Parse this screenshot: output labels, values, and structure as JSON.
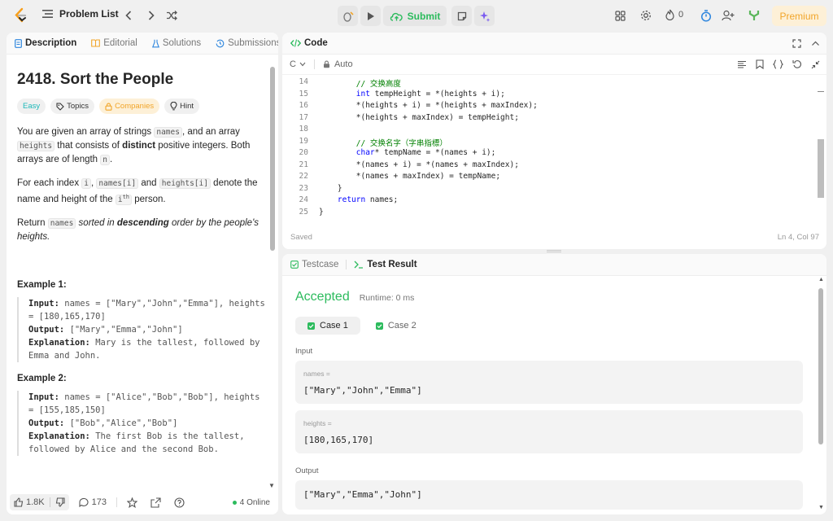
{
  "topbar": {
    "problem_list": "Problem List",
    "submit": "Submit",
    "streak": "0",
    "premium": "Premium"
  },
  "left": {
    "tabs": [
      "Description",
      "Editorial",
      "Solutions",
      "Submissions"
    ],
    "title": "2418. Sort the People",
    "tags": [
      "Easy",
      "Topics",
      "Companies",
      "Hint"
    ],
    "p1": {
      "a": "You are given an array of strings",
      "names": "names",
      "b": ", and an array",
      "heights": "heights",
      "c": "that consists of",
      "distinct": "distinct",
      "d": "positive integers. Both arrays are of length",
      "n": "n",
      "e": "."
    },
    "p2": {
      "a": "For each index",
      "i": "i",
      "names_i": "names[i]",
      "and": "and",
      "heights_i": "heights[i]",
      "b": "denote the name and height of the",
      "ith": "i",
      "sup": "th",
      "c": "person."
    },
    "p3": {
      "a": "Return",
      "names": "names",
      "b": "sorted in",
      "descending": "descending",
      "c": "order by the people's heights."
    },
    "examples": [
      {
        "title": "Example 1:",
        "input_label": "Input:",
        "input": "names = [\"Mary\",\"John\",\"Emma\"], heights = [180,165,170]",
        "output_label": "Output:",
        "output": "[\"Mary\",\"Emma\",\"John\"]",
        "expl_label": "Explanation:",
        "expl": "Mary is the tallest, followed by Emma and John."
      },
      {
        "title": "Example 2:",
        "input_label": "Input:",
        "input": "names = [\"Alice\",\"Bob\",\"Bob\"], heights = [155,185,150]",
        "output_label": "Output:",
        "output": "[\"Bob\",\"Alice\",\"Bob\"]",
        "expl_label": "Explanation:",
        "expl": "The first Bob is the tallest, followed by Alice and the second Bob."
      }
    ],
    "footer": {
      "likes": "1.8K",
      "comments": "173",
      "online": "4 Online"
    }
  },
  "code": {
    "tab": "Code",
    "lang": "C",
    "mode": "Auto",
    "lines": [
      {
        "n": "14",
        "t": "        // 交换高度",
        "c": "cm"
      },
      {
        "n": "15",
        "k": "        int",
        "t": " tempHeight = *(heights + i);"
      },
      {
        "n": "16",
        "t": "        *(heights + i) = *(heights + maxIndex);"
      },
      {
        "n": "17",
        "t": "        *(heights + maxIndex) = tempHeight;"
      },
      {
        "n": "18",
        "t": ""
      },
      {
        "n": "19",
        "t": "        // 交换名字（字串指標）",
        "c": "cm"
      },
      {
        "n": "20",
        "k": "        char",
        "t": "* tempName = *(names + i);"
      },
      {
        "n": "21",
        "t": "        *(names + i) = *(names + maxIndex);"
      },
      {
        "n": "22",
        "t": "        *(names + maxIndex) = tempName;"
      },
      {
        "n": "23",
        "t": "    }"
      },
      {
        "n": "24",
        "k": "    return",
        "t": " names;"
      },
      {
        "n": "25",
        "t": "}"
      }
    ],
    "status_left": "Saved",
    "status_right": "Ln 4, Col 97"
  },
  "result": {
    "tabs": [
      "Testcase",
      "Test Result"
    ],
    "verdict": "Accepted",
    "runtime": "Runtime: 0 ms",
    "cases": [
      "Case 1",
      "Case 2"
    ],
    "input_label": "Input",
    "names_label": "names =",
    "names_val": "[\"Mary\",\"John\",\"Emma\"]",
    "heights_label": "heights =",
    "heights_val": "[180,165,170]",
    "output_label": "Output",
    "output_val": "[\"Mary\",\"Emma\",\"John\"]"
  },
  "colors": {
    "accent_green": "#2cbb5d",
    "premium_orange": "#f1a52a",
    "easy_teal": "#1cb8b8"
  }
}
